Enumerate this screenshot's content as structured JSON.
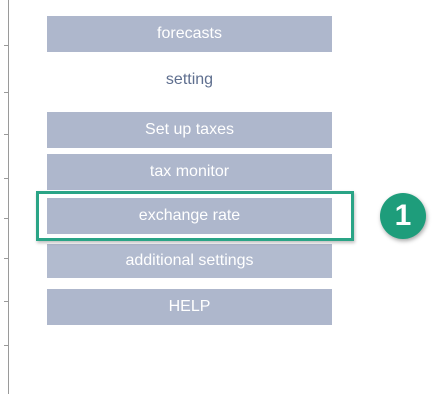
{
  "menu": {
    "items": [
      {
        "label": "forecasts",
        "style": "filled"
      },
      {
        "label": "setting",
        "style": "plain"
      },
      {
        "label": "Set up taxes",
        "style": "filled"
      },
      {
        "label": "tax monitor",
        "style": "filled"
      },
      {
        "label": "exchange rate",
        "style": "plain"
      },
      {
        "label": "additional settings",
        "style": "filled"
      },
      {
        "label": "HELP",
        "style": "filled"
      }
    ]
  },
  "callout": {
    "step_number": "1",
    "highlighted_item": "exchange rate"
  },
  "colors": {
    "button_fill": "#aeb7cc",
    "button_text": "#ffffff",
    "plain_text": "#5f6f8f",
    "highlight": "#2aa486",
    "badge": "#1e9d7b"
  }
}
